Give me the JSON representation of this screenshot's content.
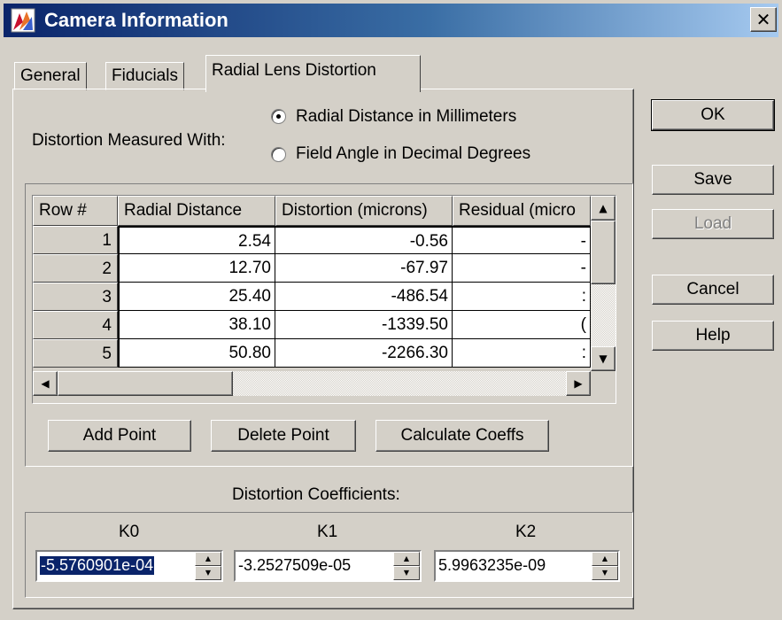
{
  "window": {
    "title": "Camera Information",
    "close_glyph": "✕"
  },
  "tabs": [
    {
      "label": "General",
      "active": false
    },
    {
      "label": "Fiducials",
      "active": false
    },
    {
      "label": "Radial Lens Distortion",
      "active": true
    }
  ],
  "distortion": {
    "measured_label": "Distortion Measured With:",
    "options": [
      {
        "label": "Radial Distance in Millimeters",
        "checked": true
      },
      {
        "label": "Field Angle in Decimal Degrees",
        "checked": false
      }
    ]
  },
  "grid": {
    "columns": [
      "Row #",
      "Radial Distance",
      "Distortion (microns)",
      "Residual (micro"
    ],
    "rows": [
      {
        "num": "1",
        "radial": "2.54",
        "distortion": "-0.56",
        "residual": "-"
      },
      {
        "num": "2",
        "radial": "12.70",
        "distortion": "-67.97",
        "residual": "-"
      },
      {
        "num": "3",
        "radial": "25.40",
        "distortion": "-486.54",
        "residual": ":"
      },
      {
        "num": "4",
        "radial": "38.10",
        "distortion": "-1339.50",
        "residual": "("
      },
      {
        "num": "5",
        "radial": "50.80",
        "distortion": "-2266.30",
        "residual": ":"
      }
    ]
  },
  "grid_buttons": {
    "add": "Add Point",
    "delete": "Delete Point",
    "calculate": "Calculate Coeffs"
  },
  "coefficients": {
    "heading": "Distortion Coefficients:",
    "k0": {
      "label": "K0",
      "value": "-5.5760901e-04"
    },
    "k1": {
      "label": "K1",
      "value": "-3.2527509e-05"
    },
    "k2": {
      "label": "K2",
      "value": "5.9963235e-09"
    }
  },
  "side_buttons": {
    "ok": "OK",
    "save": "Save",
    "load": "Load",
    "cancel": "Cancel",
    "help": "Help"
  },
  "icons": {
    "app": "camera-app-icon",
    "close": "close-icon",
    "scroll_up": "scroll-up-arrow-icon",
    "scroll_down": "scroll-down-arrow-icon",
    "scroll_left": "scroll-left-arrow-icon",
    "scroll_right": "scroll-right-arrow-icon",
    "spin_up": "spin-up-arrow-icon",
    "spin_down": "spin-down-arrow-icon"
  },
  "colors": {
    "title_start": "#0a246a",
    "title_end": "#a6caf0",
    "face": "#d4d0c8",
    "selection": "#0a246a"
  }
}
